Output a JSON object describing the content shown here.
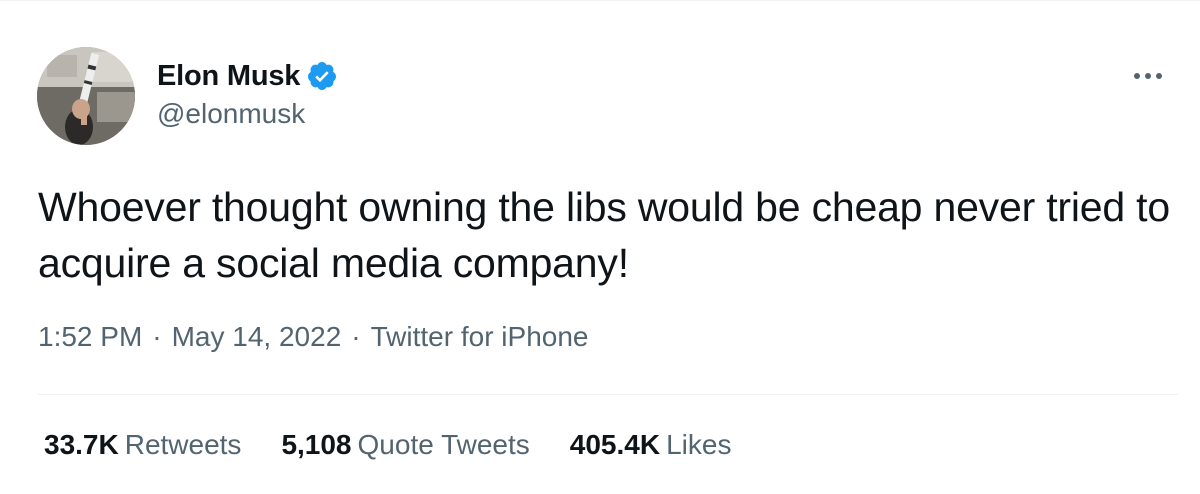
{
  "colors": {
    "text_primary": "#0f1419",
    "text_secondary": "#536471",
    "verified_blue": "#1d9bf0",
    "divider": "#eff3f4"
  },
  "author": {
    "display_name": "Elon Musk",
    "handle": "@elonmusk",
    "verified": true,
    "avatar_icon": "profile-photo",
    "verified_icon": "verified-badge-icon"
  },
  "menu": {
    "icon": "more-horizontal-icon"
  },
  "tweet": {
    "text": "Whoever thought owning the libs would be cheap never tried to acquire a social media company!",
    "time": "1:52 PM",
    "separator": "·",
    "date": "May 14, 2022",
    "source": "Twitter for iPhone"
  },
  "stats": {
    "retweets_count": "33.7K",
    "retweets_label": "Retweets",
    "quotes_count": "5,108",
    "quotes_label": "Quote Tweets",
    "likes_count": "405.4K",
    "likes_label": "Likes"
  }
}
